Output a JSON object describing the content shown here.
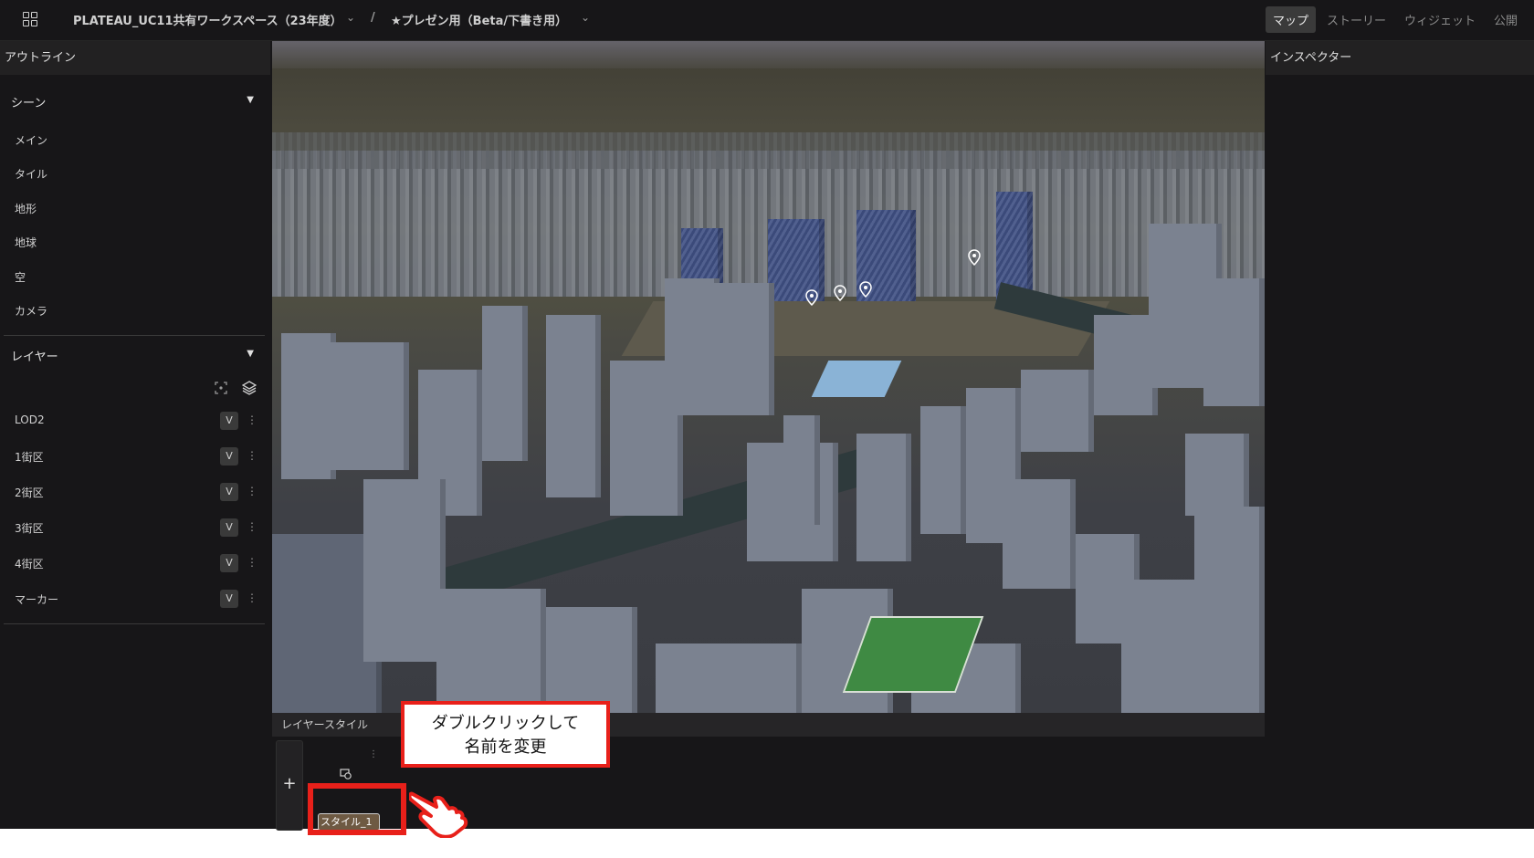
{
  "topbar": {
    "workspace": "PLATEAU_UC11共有ワークスペース（23年度）",
    "separator": "/",
    "project": "★プレゼン用（Beta/下書き用）",
    "tabs": [
      {
        "label": "マップ",
        "active": true
      },
      {
        "label": "ストーリー",
        "active": false
      },
      {
        "label": "ウィジェット",
        "active": false
      },
      {
        "label": "公開",
        "active": false
      }
    ]
  },
  "outline": {
    "title": "アウトライン",
    "scene": {
      "title": "シーン",
      "items": [
        "メイン",
        "タイル",
        "地形",
        "地球",
        "空",
        "カメラ"
      ]
    },
    "layers": {
      "title": "レイヤー",
      "items": [
        {
          "label": "LOD2",
          "badge": "V"
        },
        {
          "label": "1街区",
          "badge": "V"
        },
        {
          "label": "2街区",
          "badge": "V"
        },
        {
          "label": "3街区",
          "badge": "V"
        },
        {
          "label": "4街区",
          "badge": "V"
        },
        {
          "label": "マーカー",
          "badge": "V"
        }
      ]
    }
  },
  "inspector": {
    "title": "インスペクター"
  },
  "layer_style": {
    "title": "レイヤースタイル",
    "add_label": "+",
    "style_name": "スタイル_1"
  },
  "annotation": {
    "line1": "ダブルクリックして",
    "line2": "名前を変更"
  },
  "colors": {
    "highlight": "#e8201a",
    "active_tab": "#3a3a3a"
  },
  "icons": [
    "grid-icon",
    "chevron-down-icon",
    "caret-down-icon",
    "focus-icon",
    "layers-icon",
    "kebab-icon",
    "map-pin-icon",
    "style-icon",
    "pointing-hand-icon"
  ]
}
